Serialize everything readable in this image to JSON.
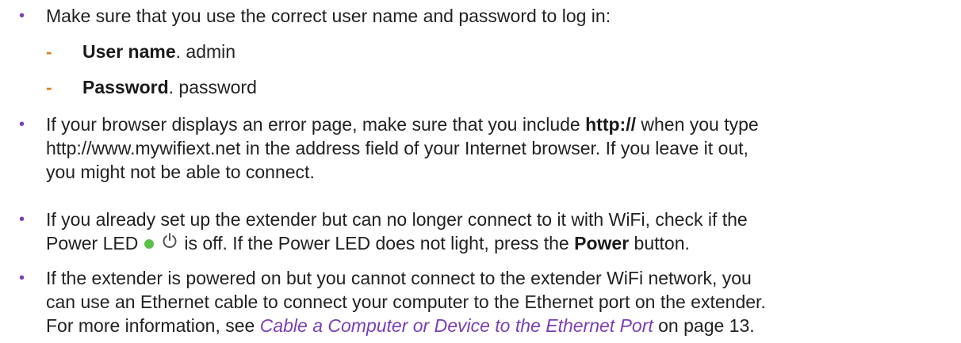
{
  "colors": {
    "bullet": "#7a3fb5",
    "dash": "#d4831c",
    "link": "#7a3fb5",
    "led": "#5cc04a"
  },
  "bullet_glyph": "•",
  "dash_glyph": "-",
  "item1": {
    "text": "Make sure that you use the correct user name and password to log in:"
  },
  "sub1": {
    "label": "User name",
    "value": ". admin"
  },
  "sub2": {
    "label": "Password",
    "value": ". password"
  },
  "item2": {
    "before": "If your browser displays an error page, make sure that you include ",
    "bold": "http://",
    "after_line1": " when you type",
    "line2": "http://www.mywifiext.net in the address field of your Internet browser. If you leave it out,",
    "line3": "you might not be able to connect."
  },
  "item3": {
    "line1": "If you already set up the extender but can no longer connect to it with WiFi, check if the",
    "line2_before": "Power LED",
    "line2_middle": "is off. If the Power LED does not light, press the ",
    "line2_bold": "Power",
    "line2_after": " button.",
    "led_icon": "led-dot-icon",
    "power_icon": "power-icon"
  },
  "item4": {
    "line1": "If the extender is powered on but you cannot connect to the extender WiFi network, you",
    "line2": "can use an Ethernet cable to connect your computer to the Ethernet port on the extender.",
    "line3_before": "For more information, see ",
    "line3_link": "Cable a Computer or Device to the Ethernet Port",
    "line3_after": " on page 13."
  }
}
